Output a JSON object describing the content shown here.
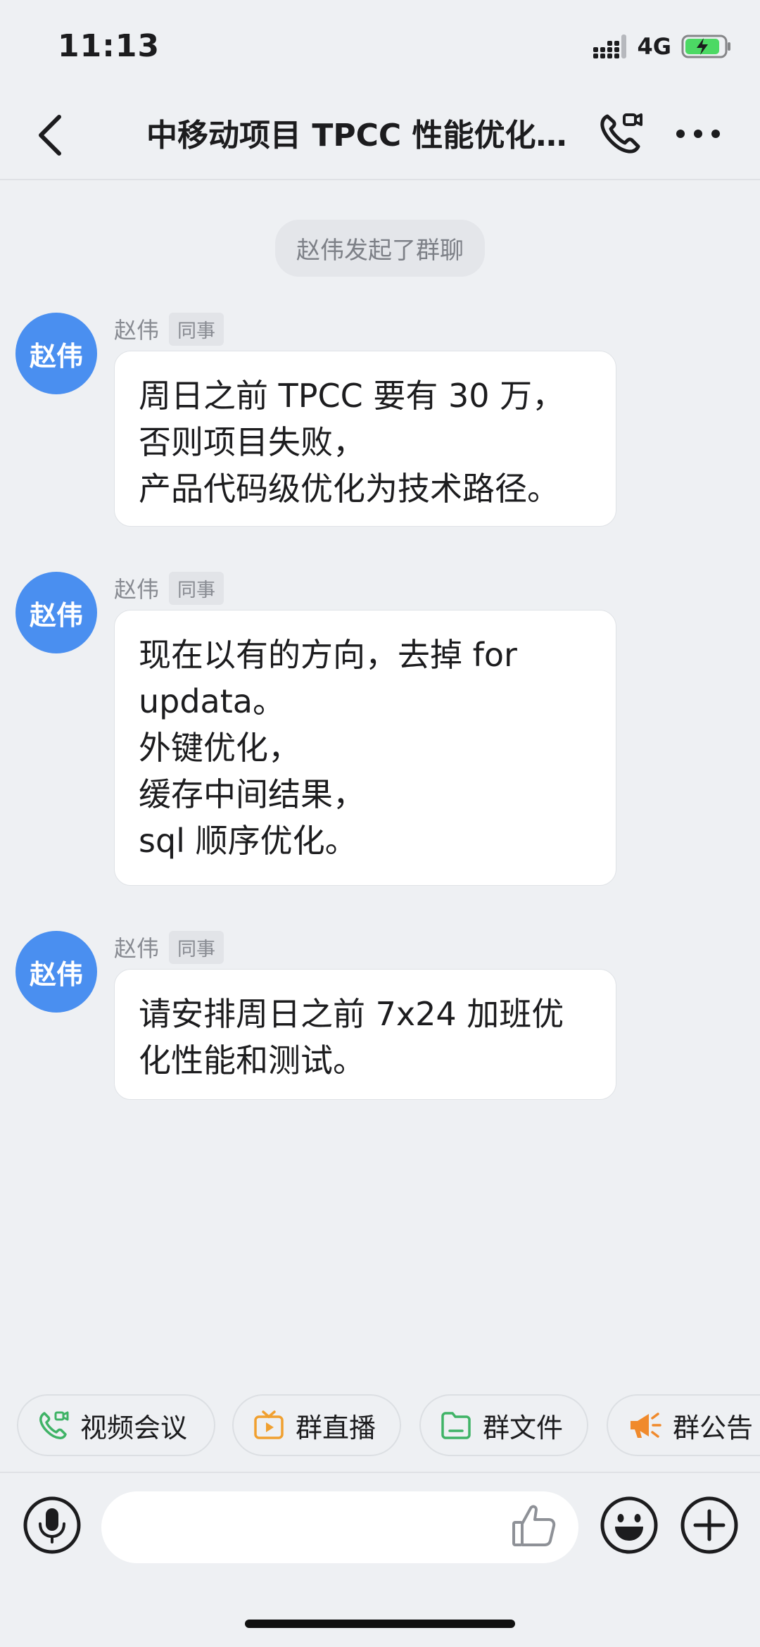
{
  "status_bar": {
    "time": "11:13",
    "network": "4G"
  },
  "nav": {
    "title": "中移动项目 TPCC 性能优化…"
  },
  "system_notice": "赵伟发起了群聊",
  "messages": [
    {
      "avatar": "赵伟",
      "sender": "赵伟",
      "tag": "同事",
      "text": "周日之前 TPCC 要有 30 万，\n否则项目失败，\n产品代码级优化为技术路径。"
    },
    {
      "avatar": "赵伟",
      "sender": "赵伟",
      "tag": "同事",
      "text": "现在以有的方向，去掉 for updata。\n外键优化，\n缓存中间结果，\nsql 顺序优化。"
    },
    {
      "avatar": "赵伟",
      "sender": "赵伟",
      "tag": "同事",
      "text": "请安排周日之前 7x24 加班优化性能和测试。"
    }
  ],
  "quick_actions": [
    {
      "label": "视频会议",
      "icon": "video-call-icon",
      "color": "#3fb366"
    },
    {
      "label": "群直播",
      "icon": "tv-live-icon",
      "color": "#f0a030"
    },
    {
      "label": "群文件",
      "icon": "folder-icon",
      "color": "#3fb366"
    },
    {
      "label": "群公告",
      "icon": "megaphone-icon",
      "color": "#f08a2c"
    }
  ],
  "colors": {
    "avatar": "#4a8ff0",
    "background": "#eef0f3",
    "bubble": "#ffffff"
  }
}
